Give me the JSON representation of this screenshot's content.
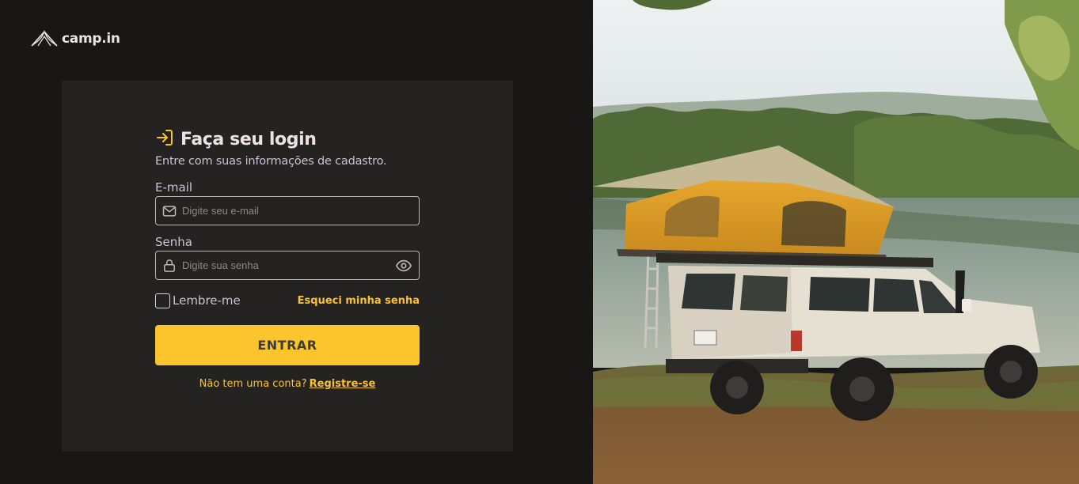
{
  "brand": {
    "name": "camp.in",
    "logo_icon": "tent-icon"
  },
  "login": {
    "title": "Faça seu login",
    "title_icon": "sign-in-arrow-icon",
    "subtitle": "Entre com suas informações de cadastro.",
    "email_label": "E-mail",
    "email_placeholder": "Digite seu e-mail",
    "email_icon": "envelope-icon",
    "password_label": "Senha",
    "password_placeholder": "Digite sua senha",
    "password_icon": "lock-icon",
    "password_toggle_icon": "eye-icon",
    "remember_label": "Lembre-me",
    "remember_checked": false,
    "forgot_label": "Esqueci minha senha",
    "submit_label": "ENTRAR",
    "signup_question": "Não tem uma conta?",
    "signup_link": "Registre-se"
  },
  "colors": {
    "background": "#181716",
    "card": "#252321",
    "accent": "#fdc52d",
    "text_light": "#e9e4df",
    "text_muted": "#c9c3d6"
  },
  "hero_image": {
    "subject": "white off-road SUV with yellow rooftop tent beside a lake"
  }
}
